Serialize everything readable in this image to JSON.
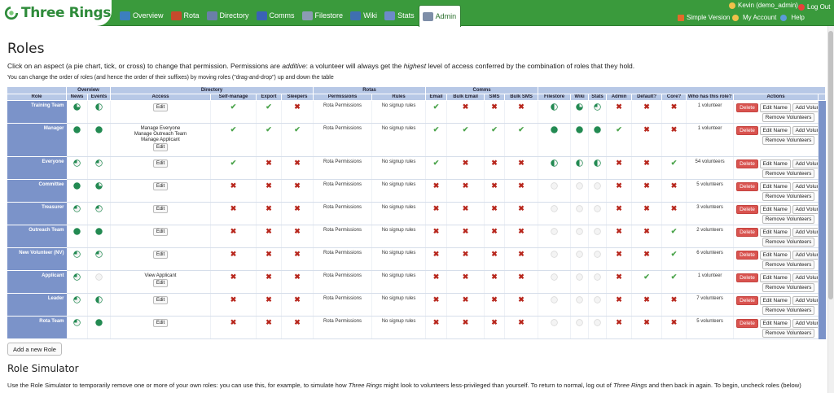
{
  "app": {
    "logo_text": "Three Rings",
    "nav": [
      {
        "label": "Overview",
        "icon": "overview-icon",
        "color": "#3c7fbd"
      },
      {
        "label": "Rota",
        "icon": "rota-icon",
        "color": "#c64a2c"
      },
      {
        "label": "Directory",
        "icon": "directory-icon",
        "color": "#6a7fa8"
      },
      {
        "label": "Comms",
        "icon": "comms-icon",
        "color": "#3a62b5"
      },
      {
        "label": "Filestore",
        "icon": "filestore-icon",
        "color": "#8b9bb3"
      },
      {
        "label": "Wiki",
        "icon": "wiki-icon",
        "color": "#3f6fb0"
      },
      {
        "label": "Stats",
        "icon": "stats-icon",
        "color": "#6d8ac9"
      },
      {
        "label": "Admin",
        "icon": "admin-icon",
        "color": "#7e8ea8",
        "active": true
      }
    ],
    "user": {
      "name": "Kevin (demo_admin)",
      "log_out": "Log Out",
      "simple_version": "Simple Version",
      "my_account": "My Account",
      "help": "Help"
    }
  },
  "page": {
    "title": "Roles",
    "intro_prefix": "Click on an aspect (a pie chart, tick, or cross) to change that permission. Permissions are ",
    "intro_additive": "additive",
    "intro_middle": ": a volunteer will always get the ",
    "intro_highest": "highest",
    "intro_suffix": " level of access conferred by the combination of roles that they hold.",
    "order_note": "You can change the order of roles (and hence the order of their suffixes) by moving roles (\"drag-and-drop\") up and down the table",
    "add_role": "Add a new Role",
    "simulator_title": "Role Simulator",
    "simulator_text_1": "Use the Role Simulator to temporarily remove one or more of your own roles: you can use this, for example, to simulate how ",
    "simulator_three_rings_1": "Three Rings",
    "simulator_text_2": " might look to volunteers less-privileged than yourself. To return to normal, log out of ",
    "simulator_three_rings_2": "Three Rings",
    "simulator_text_3": " and then back in again. To begin, uncheck roles (below)"
  },
  "table": {
    "groups": [
      {
        "label": "Overview",
        "span": 2
      },
      {
        "label": "Directory",
        "span": 4
      },
      {
        "label": "Rotas",
        "span": 2
      },
      {
        "label": "Comms",
        "span": 4
      }
    ],
    "headers": {
      "role": "Role",
      "news": "News",
      "events": "Events",
      "access": "Access",
      "self_manage": "Self-manage",
      "export": "Export",
      "sleepers": "Sleepers",
      "permissions": "Permissions",
      "rules": "Rules",
      "email": "Email",
      "bulk_email": "Bulk Email",
      "sms": "SMS",
      "bulk_sms": "Bulk SMS",
      "filestore": "Filestore",
      "wiki": "Wiki",
      "stats": "Stats",
      "admin": "Admin",
      "default": "Default?",
      "core": "Core?",
      "who": "Who has this role?",
      "actions": "Actions"
    },
    "button_labels": {
      "edit": "Edit",
      "delete": "Delete",
      "edit_name": "Edit Name",
      "add_volunteers": "Add Volunteers",
      "remove_volunteers": "Remove Volunteers",
      "rota_permissions": "Rota Permissions"
    },
    "rows": [
      {
        "name": "Training Team",
        "news": "q3",
        "events": "half",
        "access": [],
        "self_manage": "tick",
        "export": "tick",
        "sleepers": "cross",
        "rules": "No signup rules",
        "email": "tick",
        "bulk_email": "cross",
        "sms": "cross",
        "bulk_sms": "cross",
        "filestore": "half",
        "wiki": "q3",
        "stats": "q1",
        "admin": "cross",
        "default": "cross",
        "core": "cross",
        "who": "1 volunteer"
      },
      {
        "name": "Manager",
        "news": "full",
        "events": "full",
        "access": [
          "Manage Everyone",
          "Manage Outreach Team",
          "Manage Applicant"
        ],
        "self_manage": "tick",
        "export": "tick",
        "sleepers": "tick",
        "rules": "No signup rules",
        "email": "tick",
        "bulk_email": "tick",
        "sms": "tick",
        "bulk_sms": "tick",
        "filestore": "full",
        "wiki": "full",
        "stats": "full",
        "admin": "tick",
        "default": "cross",
        "core": "cross",
        "who": "1 volunteer"
      },
      {
        "name": "Everyone",
        "news": "q1",
        "events": "q1",
        "access": [],
        "self_manage": "tick",
        "export": "cross",
        "sleepers": "cross",
        "rules": "No signup rules",
        "email": "tick",
        "bulk_email": "cross",
        "sms": "cross",
        "bulk_sms": "cross",
        "filestore": "half",
        "wiki": "half",
        "stats": "half",
        "admin": "cross",
        "default": "cross",
        "core": "tick",
        "who": "54 volunteers"
      },
      {
        "name": "Committee",
        "news": "full",
        "events": "q3",
        "access": [],
        "self_manage": "cross",
        "export": "cross",
        "sleepers": "cross",
        "rules": "No signup rules",
        "email": "cross",
        "bulk_email": "cross",
        "sms": "cross",
        "bulk_sms": "cross",
        "filestore": "empty",
        "wiki": "empty",
        "stats": "empty",
        "admin": "cross",
        "default": "cross",
        "core": "cross",
        "who": "5 volunteers"
      },
      {
        "name": "Treasurer",
        "news": "q1",
        "events": "q1",
        "access": [],
        "self_manage": "cross",
        "export": "cross",
        "sleepers": "cross",
        "rules": "No signup rules",
        "email": "cross",
        "bulk_email": "cross",
        "sms": "cross",
        "bulk_sms": "cross",
        "filestore": "empty",
        "wiki": "empty",
        "stats": "empty",
        "admin": "cross",
        "default": "cross",
        "core": "cross",
        "who": "3 volunteers"
      },
      {
        "name": "Outreach Team",
        "news": "full",
        "events": "full",
        "access": [],
        "self_manage": "cross",
        "export": "cross",
        "sleepers": "cross",
        "rules": "No signup rules",
        "email": "cross",
        "bulk_email": "cross",
        "sms": "cross",
        "bulk_sms": "cross",
        "filestore": "empty",
        "wiki": "empty",
        "stats": "empty",
        "admin": "cross",
        "default": "cross",
        "core": "tick",
        "who": "2 volunteers"
      },
      {
        "name": "New Volunteer (NV)",
        "news": "q1",
        "events": "q1",
        "access": [],
        "self_manage": "cross",
        "export": "cross",
        "sleepers": "cross",
        "rules": "No signup rules",
        "email": "cross",
        "bulk_email": "cross",
        "sms": "cross",
        "bulk_sms": "cross",
        "filestore": "empty",
        "wiki": "empty",
        "stats": "empty",
        "admin": "cross",
        "default": "cross",
        "core": "tick",
        "who": "6 volunteers"
      },
      {
        "name": "Applicant",
        "news": "q1",
        "events": "empty",
        "access": [
          "View Applicant"
        ],
        "self_manage": "cross",
        "export": "cross",
        "sleepers": "cross",
        "rules": "No signup rules",
        "email": "cross",
        "bulk_email": "cross",
        "sms": "cross",
        "bulk_sms": "cross",
        "filestore": "empty",
        "wiki": "empty",
        "stats": "empty",
        "admin": "cross",
        "default": "tick",
        "core": "tick",
        "who": "1 volunteer"
      },
      {
        "name": "Leader",
        "news": "q1",
        "events": "half",
        "access": [],
        "self_manage": "cross",
        "export": "cross",
        "sleepers": "cross",
        "rules": "No signup rules",
        "email": "cross",
        "bulk_email": "cross",
        "sms": "cross",
        "bulk_sms": "cross",
        "filestore": "empty",
        "wiki": "empty",
        "stats": "empty",
        "admin": "cross",
        "default": "cross",
        "core": "cross",
        "who": "7 volunteers"
      },
      {
        "name": "Rota Team",
        "news": "q1",
        "events": "full",
        "access": [],
        "self_manage": "cross",
        "export": "cross",
        "sleepers": "cross",
        "rules": "No signup rules",
        "email": "cross",
        "bulk_email": "cross",
        "sms": "cross",
        "bulk_sms": "cross",
        "filestore": "empty",
        "wiki": "empty",
        "stats": "empty",
        "admin": "cross",
        "default": "cross",
        "core": "cross",
        "who": "5 volunteers"
      }
    ]
  },
  "colors": {
    "brand_green": "#3a9a3c",
    "pie_green": "#238a52",
    "tick": "#4aa34a",
    "cross": "#b8271d",
    "role_column": "#7b93c9",
    "header": "#b7c8e6",
    "delete": "#d9534f"
  }
}
